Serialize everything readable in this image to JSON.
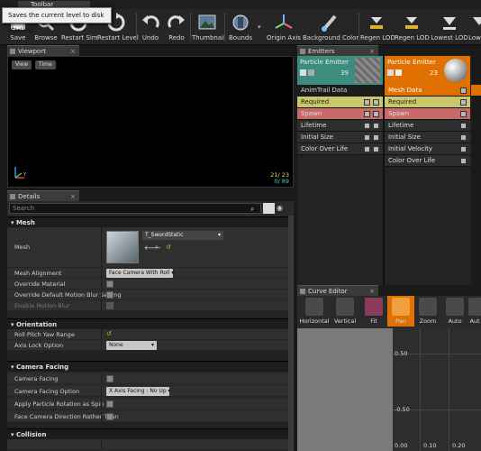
{
  "toolbar": {
    "tab_label": "Toolbar",
    "tooltip": "Saves the current level to disk (Ctrl+S)",
    "buttons": [
      {
        "label": "Save",
        "icon": "save-icon"
      },
      {
        "label": "Browse",
        "icon": "browse-icon"
      },
      {
        "label": "Restart Sim",
        "icon": "restart-sim-icon"
      },
      {
        "label": "Restart Level",
        "icon": "restart-level-icon"
      },
      {
        "label": "Undo",
        "icon": "undo-icon"
      },
      {
        "label": "Redo",
        "icon": "redo-icon"
      },
      {
        "label": "Thumbnail",
        "icon": "thumbnail-icon"
      },
      {
        "label": "Bounds",
        "icon": "bounds-icon"
      },
      {
        "label": "Origin Axis",
        "icon": "origin-axis-icon"
      },
      {
        "label": "Background Color",
        "icon": "background-color-icon"
      },
      {
        "label": "Regen LOD",
        "icon": "regen-lod-icon"
      },
      {
        "label": "Regen LOD",
        "icon": "regen-lod-icon"
      },
      {
        "label": "Lowest LOD",
        "icon": "lowest-lod-icon"
      },
      {
        "label": "Low",
        "icon": "lower-lod-icon"
      }
    ]
  },
  "viewport": {
    "tab_label": "Viewport",
    "view_button": "View",
    "time_button": "Time",
    "stats_line1": "21/ 23",
    "stats_line2": "0/ 89"
  },
  "details": {
    "tab_label": "Details",
    "search_placeholder": "Search",
    "sections": {
      "mesh": "Mesh",
      "orientation": "Orientation",
      "camera_facing": "Camera Facing",
      "collision": "Collision"
    },
    "mesh_label": "Mesh",
    "mesh_value": "T_SwordStatic",
    "mesh_alignment_label": "Mesh Alignment",
    "mesh_alignment_value": "Face Camera With Roll",
    "override_material_label": "Override Material",
    "override_motion_blur_label": "Override Default Motion Blur Setting",
    "enable_motion_blur_label": "Enable Motion Blur",
    "roll_pitch_yaw_label": "Roll Pitch Yaw Range",
    "axis_lock_label": "Axis Lock Option",
    "axis_lock_value": "None",
    "camera_facing_label": "Camera Facing",
    "camera_facing_option_label": "Camera Facing Option",
    "camera_facing_option_value": "X Axis Facing : No Up",
    "apply_rotation_label": "Apply Particle Rotation as Spin",
    "face_camera_direction_label": "Face Camera Direction Rather Than"
  },
  "emitters": {
    "tab_label": "Emitters",
    "columns": [
      {
        "name": "Particle Emitter",
        "count": "39",
        "header_color": "#3c8c7f",
        "type_label": "AnimTrail Data",
        "modules": [
          "Required",
          "Spawn",
          "Lifetime",
          "Initial Size",
          "Color Over Life"
        ]
      },
      {
        "name": "Particle Emitter",
        "count": "23",
        "header_color": "#e07000",
        "type_label": "Mesh Data",
        "modules": [
          "Required",
          "Spawn",
          "Lifetime",
          "Initial Size",
          "Initial Velocity",
          "Color Over Life"
        ]
      }
    ]
  },
  "curve_editor": {
    "tab_label": "Curve Editor",
    "buttons": [
      "Horizontal",
      "Vertical",
      "Fit",
      "Pan",
      "Zoom",
      "Auto",
      "Aut"
    ],
    "y_labels": [
      "0.50",
      "-0.50"
    ],
    "x_labels": [
      "0.00",
      "0.10",
      "0.20"
    ]
  },
  "colors": {
    "accent_orange": "#e07000",
    "required_yellow": "#c9c76a",
    "spawn_red": "#c86a6a",
    "teal": "#3c8c7f"
  }
}
